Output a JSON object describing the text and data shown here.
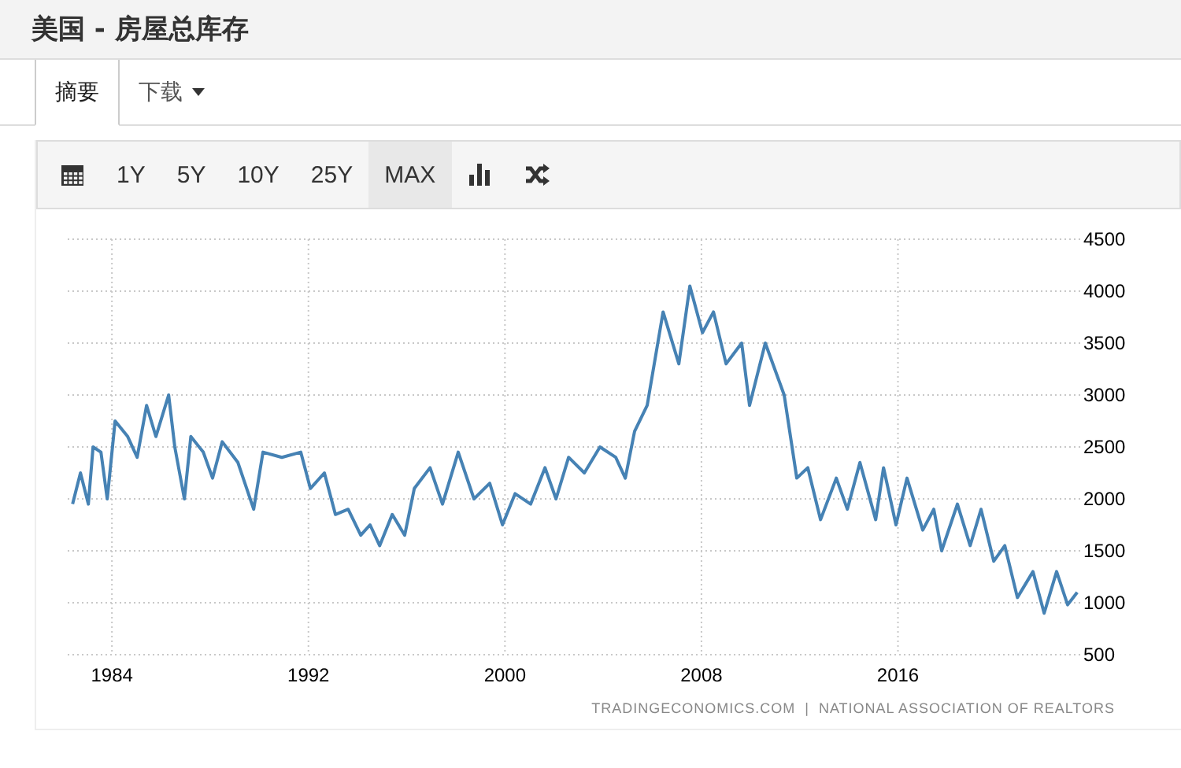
{
  "page_title": "美国 - 房屋总库存",
  "tabs": [
    {
      "label": "摘要",
      "selected": true,
      "kind": "tab"
    },
    {
      "label": "下载",
      "selected": false,
      "kind": "dropdown"
    }
  ],
  "toolbar": {
    "ranges": [
      {
        "label": "1Y",
        "selected": false
      },
      {
        "label": "5Y",
        "selected": false
      },
      {
        "label": "10Y",
        "selected": false
      },
      {
        "label": "25Y",
        "selected": false
      },
      {
        "label": "MAX",
        "selected": true
      }
    ]
  },
  "chart": {
    "chart_data": {
      "type": "line",
      "x": [
        1982.4,
        1982.72,
        1983.04,
        1983.23,
        1983.55,
        1983.81,
        1984.13,
        1984.64,
        1985.03,
        1985.41,
        1985.79,
        1986.31,
        1986.56,
        1986.95,
        1987.21,
        1987.72,
        1988.1,
        1988.49,
        1989.13,
        1989.77,
        1990.15,
        1990.92,
        1991.69,
        1992.08,
        1992.65,
        1993.1,
        1993.62,
        1994.13,
        1994.51,
        1994.9,
        1995.41,
        1995.92,
        1996.31,
        1996.95,
        1997.46,
        1998.1,
        1998.74,
        1999.38,
        1999.9,
        2000.41,
        2001.05,
        2001.63,
        2002.08,
        2002.59,
        2003.23,
        2003.87,
        2004.51,
        2004.9,
        2005.28,
        2005.79,
        2006.44,
        2007.08,
        2007.53,
        2008.04,
        2008.49,
        2009.0,
        2009.64,
        2009.96,
        2010.6,
        2011.37,
        2011.88,
        2012.33,
        2012.85,
        2013.49,
        2013.94,
        2014.45,
        2015.09,
        2015.41,
        2015.92,
        2016.37,
        2017.01,
        2017.46,
        2017.78,
        2018.42,
        2018.94,
        2019.38,
        2019.9,
        2020.35,
        2020.86,
        2021.5,
        2021.95,
        2022.46,
        2022.91,
        2023.3
      ],
      "series": [
        {
          "color": "#4682b4",
          "values": [
            1950,
            2250,
            1950,
            2500,
            2450,
            2000,
            2750,
            2600,
            2400,
            2900,
            2600,
            3000,
            2500,
            2000,
            2600,
            2450,
            2200,
            2550,
            2350,
            1900,
            2450,
            2400,
            2450,
            2100,
            2250,
            1850,
            1900,
            1650,
            1750,
            1550,
            1850,
            1650,
            2100,
            2300,
            1950,
            2450,
            2000,
            2150,
            1750,
            2050,
            1950,
            2300,
            2000,
            2400,
            2250,
            2500,
            2400,
            2200,
            2650,
            2900,
            3800,
            3300,
            4050,
            3600,
            3800,
            3300,
            3500,
            2900,
            3500,
            3000,
            2200,
            2300,
            1800,
            2200,
            1900,
            2350,
            1800,
            2300,
            1750,
            2200,
            1700,
            1900,
            1500,
            1950,
            1550,
            1900,
            1400,
            1550,
            1050,
            1300,
            900,
            1300,
            980,
            1100
          ]
        }
      ],
      "grid": true,
      "xlim": [
        1982.2,
        2023.42
      ],
      "ylim": [
        500,
        4500
      ],
      "xticks": [
        1984,
        1992,
        2000,
        2008,
        2016
      ],
      "yticks": [
        500,
        1000,
        1500,
        2000,
        2500,
        3000,
        3500,
        4000,
        4500
      ]
    },
    "source": "TRADINGECONOMICS.COM  |  NATIONAL ASSOCIATION OF REALTORS"
  }
}
